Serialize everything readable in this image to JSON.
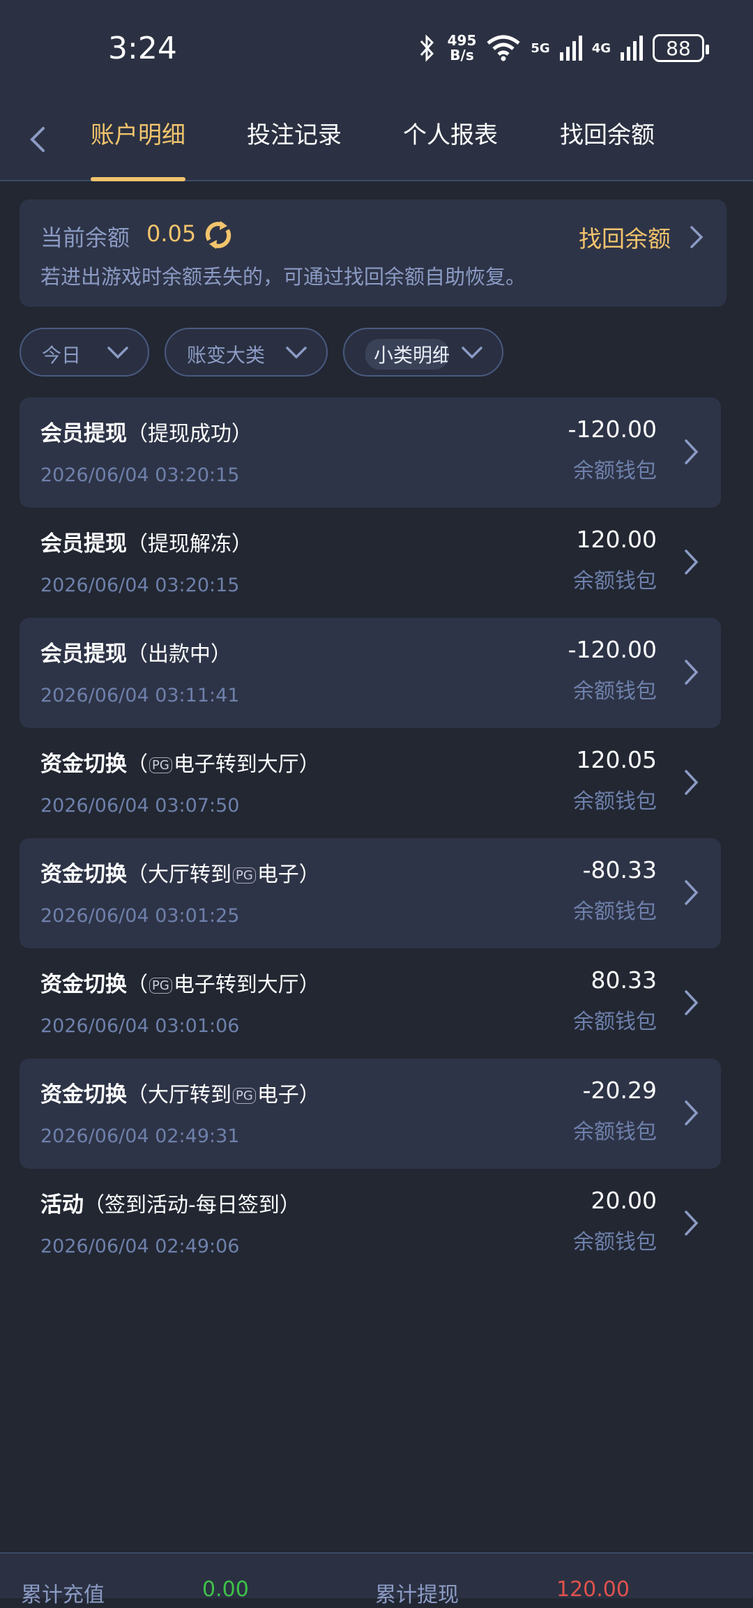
{
  "status_bar": {
    "time": "3:24",
    "net_speed_value": "495",
    "net_speed_unit": "B/s",
    "signal_5g": "5G",
    "signal_4g": "4G",
    "battery": "88"
  },
  "nav": {
    "tabs": [
      {
        "label": "账户明细",
        "active": true
      },
      {
        "label": "投注记录",
        "active": false
      },
      {
        "label": "个人报表",
        "active": false
      },
      {
        "label": "找回余额",
        "active": false
      }
    ]
  },
  "balance": {
    "label": "当前余额",
    "value": "0.05",
    "recover_label": "找回余额",
    "hint": "若进出游戏时余额丢失的，可通过找回余额自助恢复。"
  },
  "filters": {
    "date": "今日",
    "category": "账变大类",
    "subcategory": "小类明细"
  },
  "records": [
    {
      "type": "会员提现",
      "detail": "（提现成功）",
      "time": "2026/06/04 03:20:15",
      "amount": "-120.00",
      "wallet": "余额钱包"
    },
    {
      "type": "会员提现",
      "detail": "（提现解冻）",
      "time": "2026/06/04 03:20:15",
      "amount": "120.00",
      "wallet": "余额钱包"
    },
    {
      "type": "会员提现",
      "detail": "（出款中）",
      "time": "2026/06/04 03:11:41",
      "amount": "-120.00",
      "wallet": "余额钱包"
    },
    {
      "type": "资金切换",
      "detail_pre": "（",
      "pg": "PG",
      "detail_post": "电子转到大厅）",
      "time": "2026/06/04 03:07:50",
      "amount": "120.05",
      "wallet": "余额钱包"
    },
    {
      "type": "资金切换",
      "detail_pre": "（大厅转到",
      "pg": "PG",
      "detail_post": "电子）",
      "time": "2026/06/04 03:01:25",
      "amount": "-80.33",
      "wallet": "余额钱包"
    },
    {
      "type": "资金切换",
      "detail_pre": "（",
      "pg": "PG",
      "detail_post": "电子转到大厅）",
      "time": "2026/06/04 03:01:06",
      "amount": "80.33",
      "wallet": "余额钱包"
    },
    {
      "type": "资金切换",
      "detail_pre": "（大厅转到",
      "pg": "PG",
      "detail_post": "电子）",
      "time": "2026/06/04 02:49:31",
      "amount": "-20.29",
      "wallet": "余额钱包"
    },
    {
      "type": "活动",
      "detail": "（签到活动-每日签到）",
      "time": "2026/06/04 02:49:06",
      "amount": "20.00",
      "wallet": "余额钱包"
    }
  ],
  "footer": {
    "deposit_label": "累计充值",
    "deposit_value": "0.00",
    "withdraw_label": "累计提现",
    "withdraw_value": "120.00"
  },
  "colors": {
    "accent": "#f2c46d",
    "positive": "#3ec24a",
    "negative": "#e0524e",
    "muted": "#6e80ab"
  }
}
